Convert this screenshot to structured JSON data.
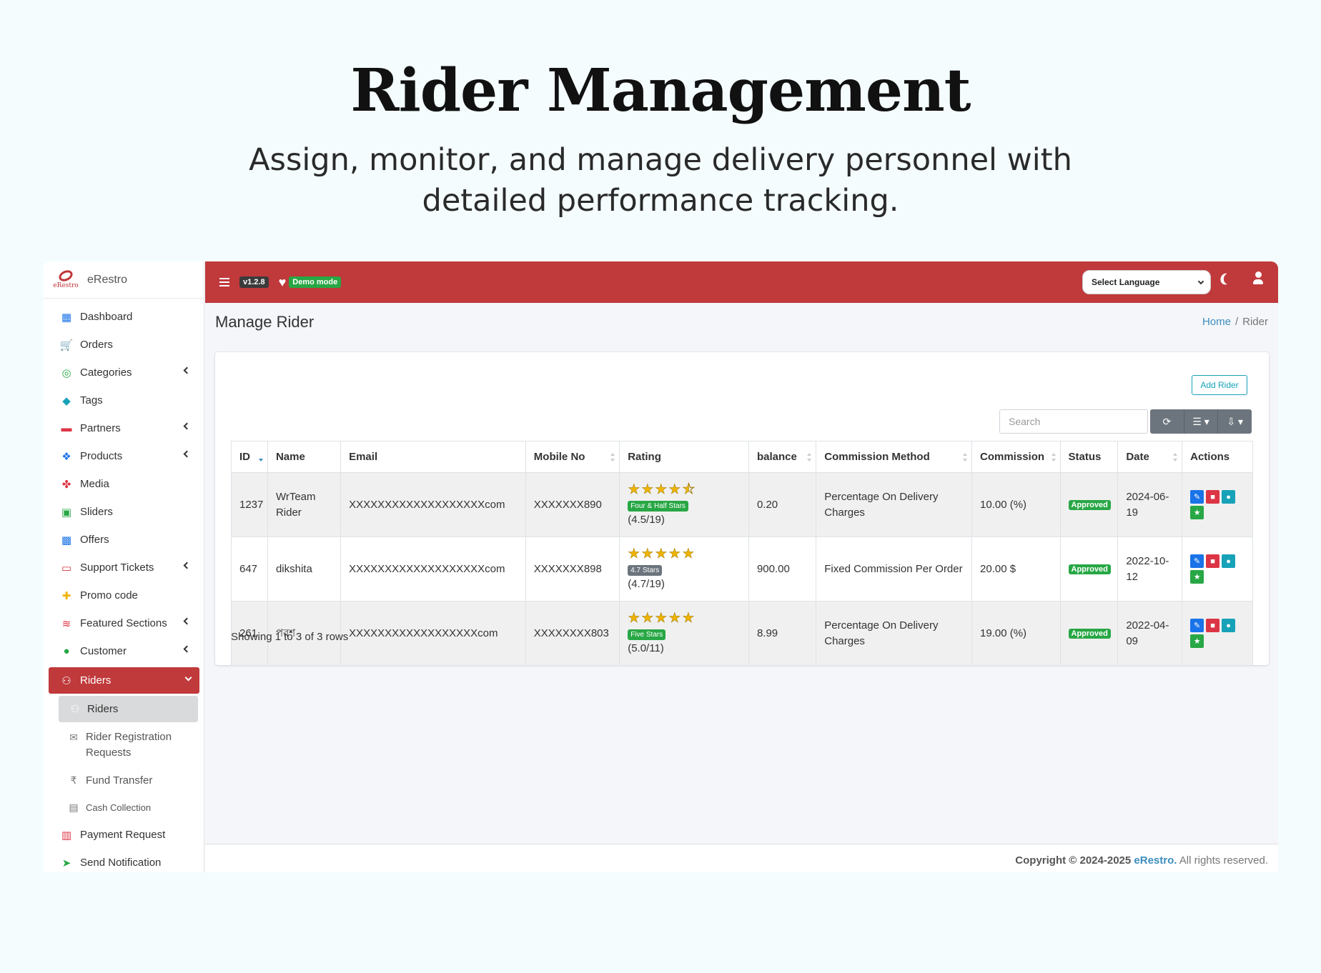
{
  "hero": {
    "title": "Rider Management",
    "subtitle": "Assign, monitor, and manage delivery personnel with detailed performance tracking."
  },
  "brand": {
    "name": "eRestro",
    "logo_text": "eRestro",
    "accent": "#c0393b"
  },
  "sidebar": {
    "items": [
      {
        "label": "Dashboard",
        "icon": "dashboard-icon"
      },
      {
        "label": "Orders",
        "icon": "cart-icon"
      },
      {
        "label": "Categories",
        "icon": "target-icon",
        "expandable": true
      },
      {
        "label": "Tags",
        "icon": "tag-icon"
      },
      {
        "label": "Partners",
        "icon": "store-icon",
        "expandable": true
      },
      {
        "label": "Products",
        "icon": "cubes-icon",
        "expandable": true
      },
      {
        "label": "Media",
        "icon": "media-icon"
      },
      {
        "label": "Sliders",
        "icon": "image-icon"
      },
      {
        "label": "Offers",
        "icon": "gift-icon"
      },
      {
        "label": "Support Tickets",
        "icon": "ticket-icon",
        "expandable": true
      },
      {
        "label": "Promo code",
        "icon": "puzzle-icon"
      },
      {
        "label": "Featured Sections",
        "icon": "layers-icon",
        "expandable": true
      },
      {
        "label": "Customer",
        "icon": "user-icon",
        "expandable": true
      },
      {
        "label": "Riders",
        "icon": "motorcycle-icon",
        "expandable": true,
        "active": true
      }
    ],
    "riders_sub": [
      {
        "label": "Riders",
        "icon": "motorcycle-icon"
      },
      {
        "label": "Rider Registration Requests",
        "icon": "envelope-icon"
      },
      {
        "label": "Fund Transfer",
        "icon": "rupee-icon"
      },
      {
        "label": "Cash Collection",
        "icon": "money-icon"
      }
    ],
    "after": [
      {
        "label": "Payment Request",
        "icon": "money-bill-icon"
      },
      {
        "label": "Send Notification",
        "icon": "paper-plane-icon"
      }
    ]
  },
  "topbar": {
    "version": "v1.2.8",
    "demo": "Demo mode",
    "language_select": "Select Language"
  },
  "page": {
    "title": "Manage Rider",
    "breadcrumb": {
      "home": "Home",
      "separator": "/",
      "current": "Rider"
    }
  },
  "table_tools": {
    "add_label": "Add Rider",
    "search_placeholder": "Search"
  },
  "table": {
    "columns": [
      "ID",
      "Name",
      "Email",
      "Mobile No",
      "Rating",
      "balance",
      "Commission Method",
      "Commission",
      "Status",
      "Date",
      "Actions"
    ],
    "rows": [
      {
        "id": "1237",
        "name": "WrTeam Rider",
        "email": "XXXXXXXXXXXXXXXXXXXcom",
        "mobile": "XXXXXXX890",
        "stars": "★★★★⯪",
        "rating_badge": "Four & Half Stars",
        "rating_value": "(4.5/19)",
        "balance": "0.20",
        "method": "Percentage On Delivery Charges",
        "commission": "10.00 (%)",
        "status": "Approved",
        "date": "2024-06-19"
      },
      {
        "id": "647",
        "name": "dikshita",
        "email": "XXXXXXXXXXXXXXXXXXXcom",
        "mobile": "XXXXXXX898",
        "stars": "★★★★★",
        "rating_badge": "4.7 Stars",
        "rating_value": "(4.7/19)",
        "balance": "900.00",
        "method": "Fixed Commission Per Order",
        "commission": "20.00 $",
        "status": "Approved",
        "date": "2022-10-12"
      },
      {
        "id": "261",
        "name": "পরশ",
        "email": "XXXXXXXXXXXXXXXXXXcom",
        "mobile": "XXXXXXXX803",
        "stars": "★★★★★",
        "rating_badge": "Five Stars",
        "rating_value": "(5.0/11)",
        "balance": "8.99",
        "method": "Percentage On Delivery Charges",
        "commission": "19.00 (%)",
        "status": "Approved",
        "date": "2022-04-09"
      }
    ],
    "summary": "Showing 1 to 3 of 3 rows"
  },
  "footer": {
    "prefix": "Copyright © 2024-2025",
    "brand": "eRestro.",
    "suffix": "All rights reserved."
  }
}
